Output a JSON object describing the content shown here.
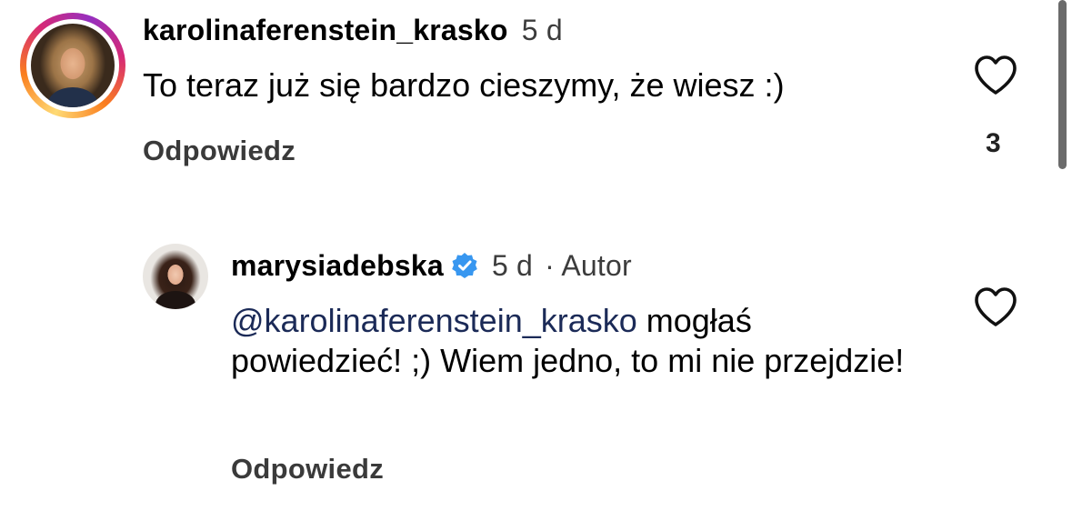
{
  "comments": [
    {
      "username": "karolinaferenstein_krasko",
      "time": "5 d",
      "text": "To teraz już się bardzo cieszymy, że wiesz :)",
      "reply_label": "Odpowiedz",
      "like_count": "3"
    },
    {
      "username": "marysiadebska",
      "time": "5 d",
      "author_tag": "· Autor",
      "mention": "@karolinaferenstein_krasko",
      "text": " mogłaś powiedzieć! ;) Wiem jedno, to mi nie przejdzie!",
      "reply_label": "Odpowiedz"
    }
  ],
  "colors": {
    "verified_badge": "#3897f0",
    "mention": "#1b2a57"
  },
  "icons": {
    "like": "heart-outline-icon",
    "verified": "verified-badge-icon"
  }
}
